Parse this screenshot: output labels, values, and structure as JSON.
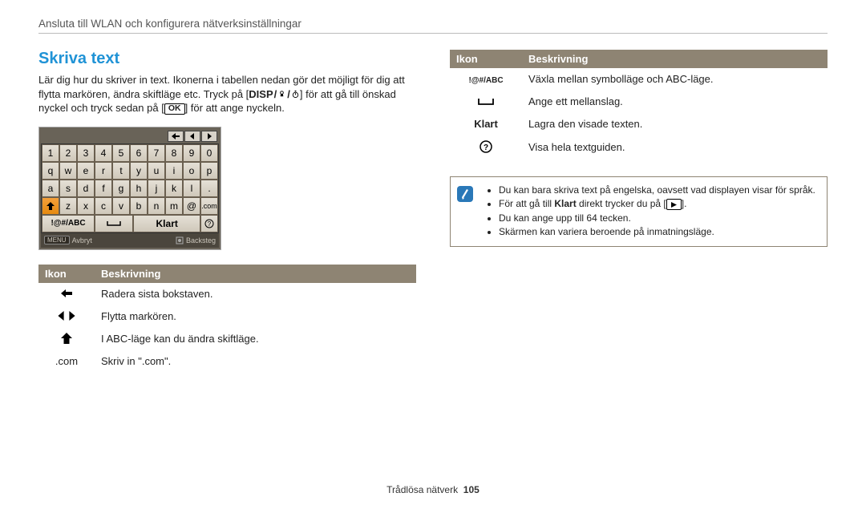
{
  "header": {
    "title": "Ansluta till WLAN och konfigurera nätverksinställningar"
  },
  "section": {
    "title": "Skriva text",
    "intro_part1": "Lär dig hur du skriver in text. Ikonerna i tabellen nedan gör det möjligt för dig att flytta markören, ändra skiftläge etc. Tryck på [",
    "intro_disp": "DISP",
    "intro_part2": "] för att gå till önskad nyckel och tryck sedan på [",
    "intro_ok": "OK",
    "intro_part3": "] för att ange nyckeln."
  },
  "keyboard": {
    "rows": [
      [
        "1",
        "2",
        "3",
        "4",
        "5",
        "6",
        "7",
        "8",
        "9",
        "0"
      ],
      [
        "q",
        "w",
        "e",
        "r",
        "t",
        "y",
        "u",
        "i",
        "o",
        "p"
      ],
      [
        "a",
        "s",
        "d",
        "f",
        "g",
        "h",
        "j",
        "k",
        "l",
        "."
      ],
      [
        "",
        "z",
        "x",
        "c",
        "v",
        "b",
        "n",
        "m",
        "@",
        ".com"
      ]
    ],
    "shift_highlight": true,
    "abc_label": "!@#/ABC",
    "klart_label": "Klart",
    "footer_left": "Avbryt",
    "footer_left_btn": "MENU",
    "footer_right": "Backsteg"
  },
  "table_headers": {
    "icon": "Ikon",
    "desc": "Beskrivning"
  },
  "left_table": {
    "rows": [
      {
        "desc": "Radera sista bokstaven."
      },
      {
        "desc": "Flytta markören."
      },
      {
        "desc": "I ABC-läge kan du ändra skiftläge."
      },
      {
        "icon_text": ".com",
        "desc": "Skriv in \".com\"."
      }
    ]
  },
  "right_table": {
    "rows": [
      {
        "icon_text": "!@#/ABC",
        "desc": "Växla mellan symbolläge och ABC-läge."
      },
      {
        "desc": "Ange ett mellanslag."
      },
      {
        "icon_text": "Klart",
        "desc": "Lagra den visade texten."
      },
      {
        "desc": "Visa hela textguiden."
      }
    ]
  },
  "notes": {
    "items": [
      {
        "text_prefix": "Du kan bara skriva text på engelska, oavsett vad displayen visar för språk."
      },
      {
        "text_prefix": "För att gå till ",
        "bold": "Klart",
        "text_mid": " direkt trycker du på [",
        "icon": true,
        "text_suffix": "]."
      },
      {
        "text_prefix": "Du kan ange upp till 64 tecken."
      },
      {
        "text_prefix": "Skärmen kan variera beroende på inmatningsläge."
      }
    ]
  },
  "footer": {
    "section": "Trådlösa nätverk",
    "page": "105"
  }
}
